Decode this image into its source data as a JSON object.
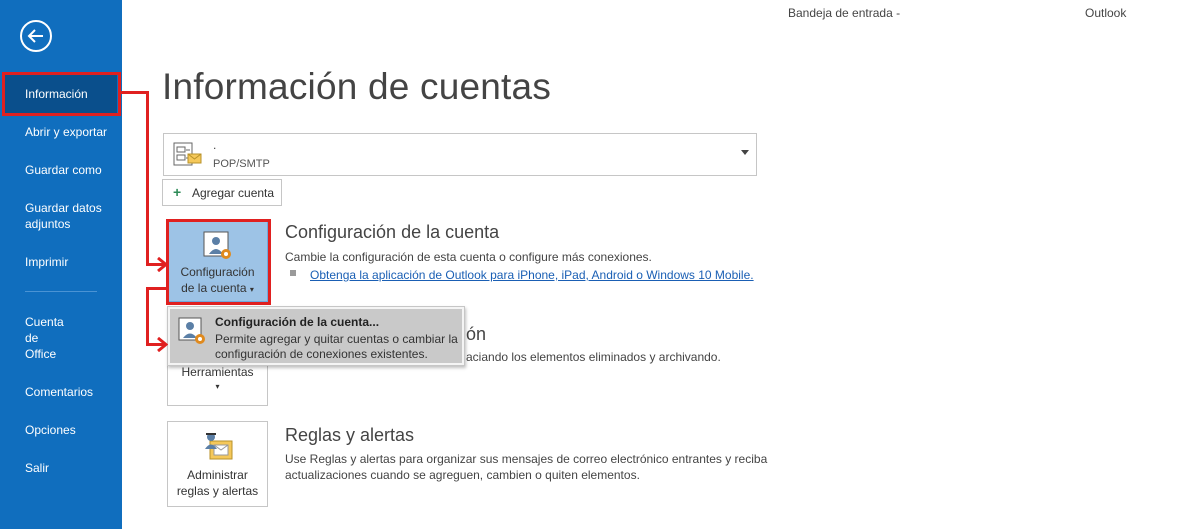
{
  "titlebar": {
    "context": "Bandeja de entrada -",
    "app": "Outlook"
  },
  "sidebar": {
    "items": [
      {
        "label": "Información"
      },
      {
        "label": "Abrir y exportar"
      },
      {
        "label": "Guardar como"
      },
      {
        "label": "Guardar datos adjuntos"
      },
      {
        "label": "Imprimir"
      },
      {
        "label": "Cuenta de Office"
      },
      {
        "label": "Comentarios"
      },
      {
        "label": "Opciones"
      },
      {
        "label": "Salir"
      }
    ]
  },
  "page": {
    "title": "Información de cuentas"
  },
  "account": {
    "name": ".",
    "type": "POP/SMTP"
  },
  "add_account": {
    "label": "Agregar cuenta"
  },
  "account_settings": {
    "button_line1": "Configuración",
    "button_line2": "de la cuenta",
    "title": "Configuración de la cuenta",
    "desc": "Cambie la configuración de esta cuenta o configure más conexiones.",
    "link": "Obtenga la aplicación de Outlook para iPhone, iPad, Android o Windows 10 Mobile."
  },
  "cleanup": {
    "title_partial": "ón",
    "desc_partial": "aciando los elementos eliminados y archivando.",
    "button_label": "Herramientas"
  },
  "rules": {
    "button_line1": "Administrar",
    "button_line2": "reglas y alertas",
    "title": "Reglas y alertas",
    "desc_line1": "Use Reglas y alertas para organizar sus mensajes de correo electrónico entrantes y reciba",
    "desc_line2": "actualizaciones cuando se agreguen, cambien o quiten elementos."
  },
  "dropdown": {
    "title": "Configuración de la cuenta...",
    "desc": "Permite agregar y quitar cuentas o cambiar la configuración de conexiones existentes."
  },
  "colors": {
    "sidebar": "#106ebe",
    "selected": "#0a4f8c",
    "highlight": "#e02020",
    "link": "#1a5fb4"
  }
}
